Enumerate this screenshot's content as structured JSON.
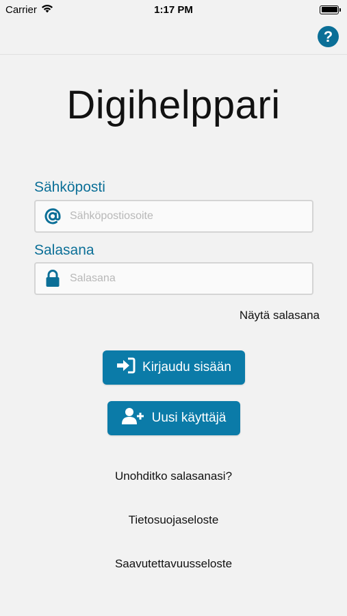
{
  "status_bar": {
    "carrier": "Carrier",
    "time": "1:17 PM"
  },
  "nav": {
    "help_label": "?"
  },
  "app": {
    "title": "Digihelppari"
  },
  "email": {
    "label": "Sähköposti",
    "placeholder": "Sähköpostiosoite",
    "value": ""
  },
  "password": {
    "label": "Salasana",
    "placeholder": "Salasana",
    "value": ""
  },
  "show_password_label": "Näytä salasana",
  "buttons": {
    "login_label": "Kirjaudu sisään",
    "new_user_label": "Uusi käyttäjä"
  },
  "links": {
    "forgot_password": "Unohditko salasanasi?",
    "privacy": "Tietosuojaseloste",
    "accessibility": "Saavutettavuusseloste"
  },
  "colors": {
    "accent": "#0b6f97",
    "button": "#0b7ba8",
    "background": "#f2f2f2"
  },
  "icons": {
    "wifi": "wifi-icon",
    "battery": "battery-icon",
    "help": "help-icon",
    "email": "at-icon",
    "password": "lock-icon",
    "login": "sign-in-icon",
    "new_user": "add-user-icon"
  }
}
